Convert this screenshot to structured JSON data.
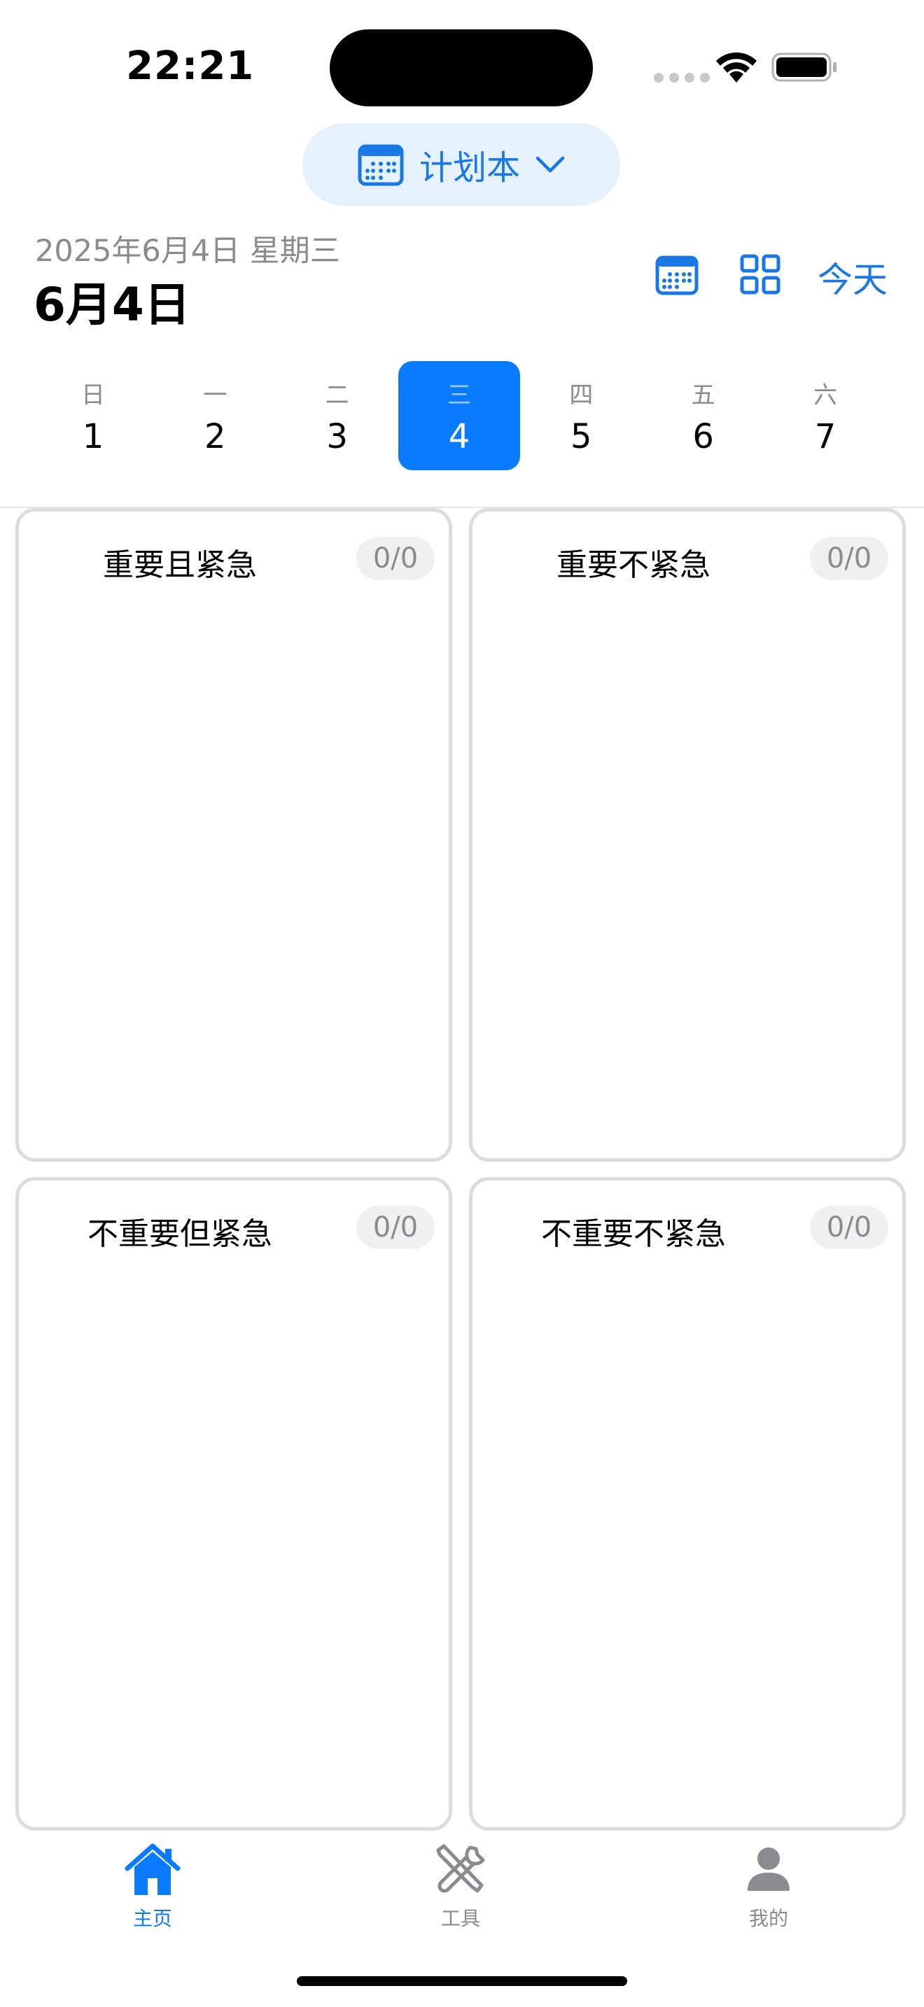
{
  "status_bar": {
    "time": "22:21"
  },
  "selector": {
    "label": "计划本"
  },
  "header": {
    "date_sub": "2025年6月4日 星期三",
    "date_main": "6月4日",
    "today_label": "今天"
  },
  "week": [
    {
      "weekday": "日",
      "day": "1"
    },
    {
      "weekday": "一",
      "day": "2"
    },
    {
      "weekday": "二",
      "day": "3"
    },
    {
      "weekday": "三",
      "day": "4"
    },
    {
      "weekday": "四",
      "day": "5"
    },
    {
      "weekday": "五",
      "day": "6"
    },
    {
      "weekday": "六",
      "day": "7"
    }
  ],
  "quadrants": [
    {
      "title": "重要且紧急",
      "count": "0/0"
    },
    {
      "title": "重要不紧急",
      "count": "0/0"
    },
    {
      "title": "不重要但紧急",
      "count": "0/0"
    },
    {
      "title": "不重要不紧急",
      "count": "0/0"
    }
  ],
  "tabs": [
    {
      "label": "主页"
    },
    {
      "label": "工具"
    },
    {
      "label": "我的"
    }
  ],
  "colors": {
    "accent": "#0a7aff",
    "selector_bg": "#e5f1fd",
    "border": "#dcdcdc",
    "muted_text": "#8a8a8f"
  }
}
